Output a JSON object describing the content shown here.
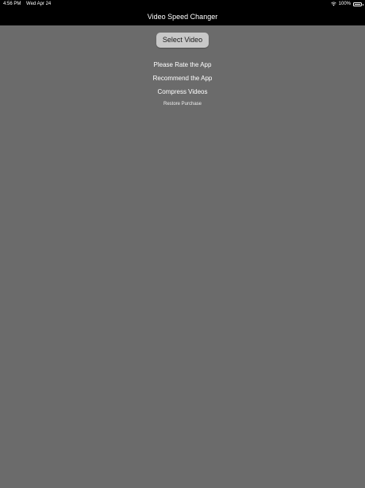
{
  "status_bar": {
    "time": "4:56 PM",
    "date": "Wed Apr 24",
    "battery": "100%",
    "icons": [
      "wifi-icon",
      "battery-icon"
    ]
  },
  "nav": {
    "title": "Video Speed Changer"
  },
  "main": {
    "select_video_label": "Select Video",
    "links": {
      "rate": "Please Rate the App",
      "recommend": "Recommend the App",
      "compress": "Compress Videos",
      "restore": "Restore Purchase"
    }
  },
  "colors": {
    "background": "#6b6b6b",
    "bar": "#000000",
    "button": "#c8c8c8"
  }
}
